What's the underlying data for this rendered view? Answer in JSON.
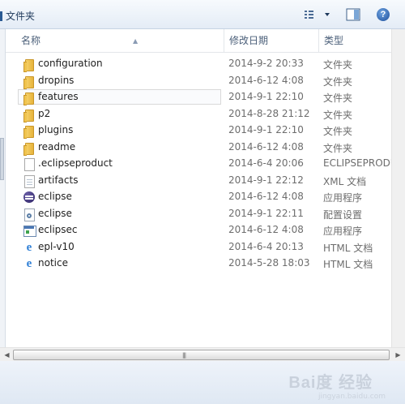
{
  "window": {
    "title": "文件夹"
  },
  "columns": {
    "name": "名称",
    "date": "修改日期",
    "type": "类型"
  },
  "files": [
    {
      "name": "configuration",
      "date": "2014-9-2 20:33",
      "type": "文件夹",
      "icon": "folder-icon"
    },
    {
      "name": "dropins",
      "date": "2014-6-12 4:08",
      "type": "文件夹",
      "icon": "folder-icon"
    },
    {
      "name": "features",
      "date": "2014-9-1 22:10",
      "type": "文件夹",
      "icon": "folder-icon"
    },
    {
      "name": "p2",
      "date": "2014-8-28 21:12",
      "type": "文件夹",
      "icon": "folder-icon"
    },
    {
      "name": "plugins",
      "date": "2014-9-1 22:10",
      "type": "文件夹",
      "icon": "folder-icon"
    },
    {
      "name": "readme",
      "date": "2014-6-12 4:08",
      "type": "文件夹",
      "icon": "folder-icon"
    },
    {
      "name": ".eclipseproduct",
      "date": "2014-6-4 20:06",
      "type": "ECLIPSEPRODUCT",
      "icon": "document-icon"
    },
    {
      "name": "artifacts",
      "date": "2014-9-1 22:12",
      "type": "XML 文档",
      "icon": "xml-document-icon"
    },
    {
      "name": "eclipse",
      "date": "2014-6-12 4:08",
      "type": "应用程序",
      "icon": "eclipse-icon"
    },
    {
      "name": "eclipse",
      "date": "2014-9-1 22:11",
      "type": "配置设置",
      "icon": "settings-file-icon"
    },
    {
      "name": "eclipsec",
      "date": "2014-6-12 4:08",
      "type": "应用程序",
      "icon": "application-icon"
    },
    {
      "name": "epl-v10",
      "date": "2014-6-4 20:13",
      "type": "HTML 文档",
      "icon": "ie-html-icon"
    },
    {
      "name": "notice",
      "date": "2014-5-28 18:03",
      "type": "HTML 文档",
      "icon": "ie-html-icon"
    }
  ],
  "watermark": {
    "text": "Bai度 经验",
    "sub": "jingyan.baidu.com"
  }
}
